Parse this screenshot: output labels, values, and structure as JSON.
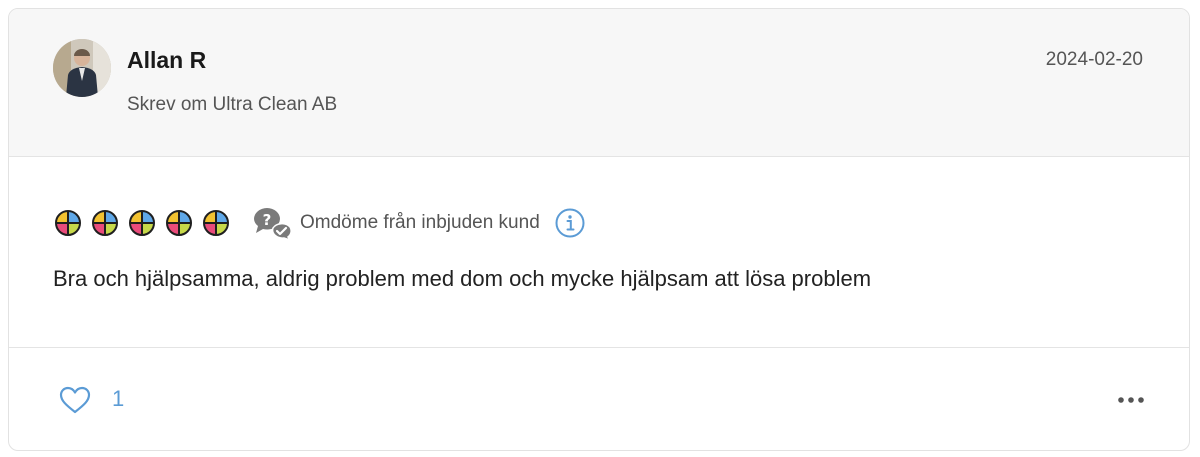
{
  "review": {
    "author_name": "Allan R",
    "subtitle": "Skrev om Ultra Clean AB",
    "date": "2024-02-20",
    "rating": 5,
    "rating_max": 5,
    "invite_label": "Omdöme från inbjuden kund",
    "text": "Bra och hjälpsamma, aldrig problem med dom och mycke hjälpsam att lösa problem",
    "like_count": "1"
  },
  "icons": {
    "rating": "segmented-circle-icon",
    "invite": "chat-bubbles-question-icon",
    "info": "info-circle-icon",
    "like": "heart-outline-icon",
    "more": "ellipsis-icon"
  },
  "colors": {
    "rating_top": "#f2c230",
    "rating_left": "#e94b7a",
    "rating_right": "#5fa8e8",
    "rating_bottom": "#c7d94a",
    "link_blue": "#5b9bd5",
    "header_bg": "#f7f7f7"
  }
}
